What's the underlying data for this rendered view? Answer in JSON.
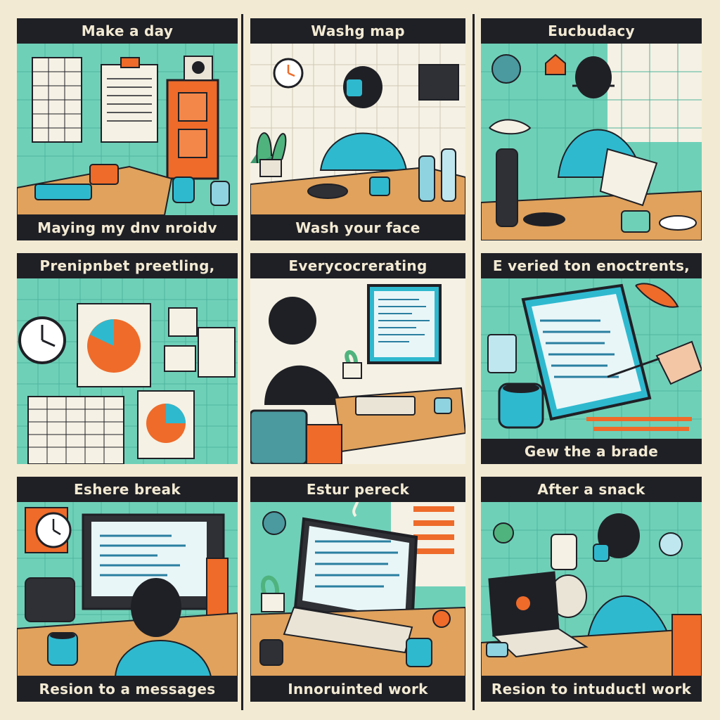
{
  "colors": {
    "teal": "#6fd0b8",
    "mint": "#9fe1cf",
    "cream": "#f3ead3",
    "ink": "#1f2026",
    "orange": "#ee6b2a",
    "wood": "#e0a25c",
    "cyan": "#2fb9cf"
  },
  "panels": [
    {
      "id": "p1",
      "top": "Make a day",
      "bottom": "Maying my dnv nroidv"
    },
    {
      "id": "p2",
      "top": "Washg map",
      "bottom": "Wash your face"
    },
    {
      "id": "p3",
      "top": "Eucbudacy",
      "bottom": ""
    },
    {
      "id": "p4",
      "top": "Prenipnbet preetling,",
      "bottom": ""
    },
    {
      "id": "p5",
      "top": "Everycocrerating",
      "bottom": ""
    },
    {
      "id": "p6",
      "top": "E veried ton enoctrents,",
      "bottom": "Gew the a brade"
    },
    {
      "id": "p7",
      "top": "Eshere break",
      "bottom": "Resion to a messages"
    },
    {
      "id": "p8",
      "top": "Estur pereck",
      "bottom": "Innoruinted work"
    },
    {
      "id": "p9",
      "top": "After a snack",
      "bottom": "Resion to intuductl work"
    }
  ]
}
